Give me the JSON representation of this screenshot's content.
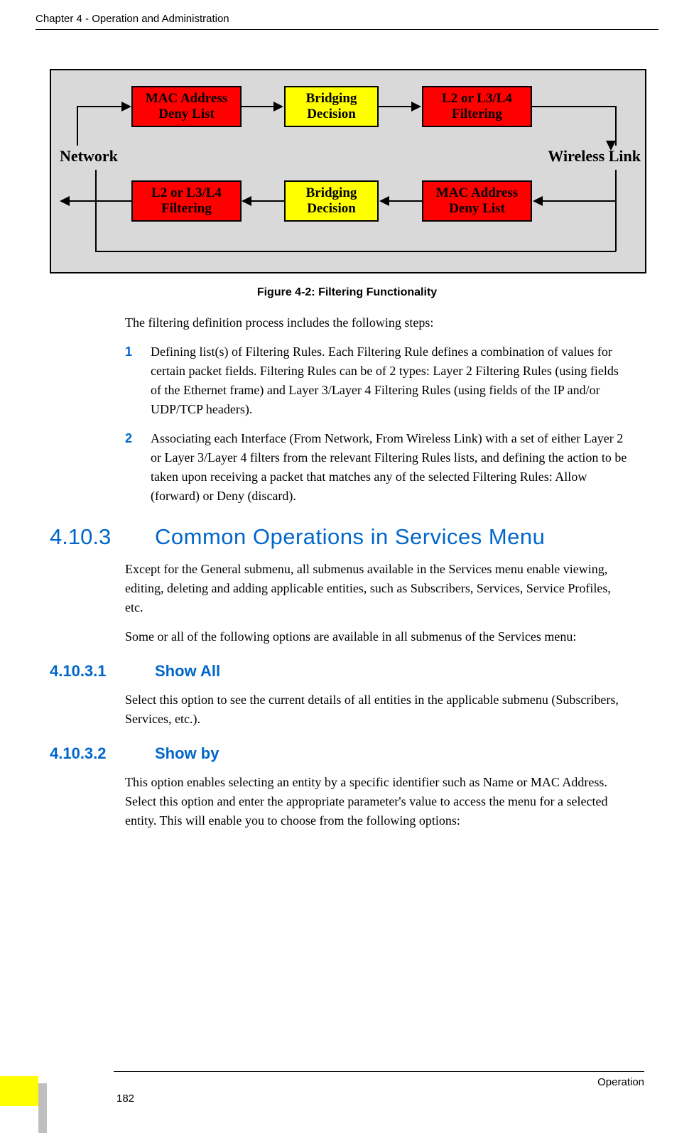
{
  "header": {
    "chapter_line": "Chapter 4 - Operation and Administration"
  },
  "diagram": {
    "network_label": "Network",
    "wireless_label": "Wireless Link",
    "top": {
      "box1_l1": "MAC Address",
      "box1_l2": "Deny List",
      "box2_l1": "Bridging",
      "box2_l2": "Decision",
      "box3_l1": "L2 or L3/L4",
      "box3_l2": "Filtering"
    },
    "bottom": {
      "box1_l1": "L2 or L3/L4",
      "box1_l2": "Filtering",
      "box2_l1": "Bridging",
      "box2_l2": "Decision",
      "box3_l1": "MAC Address",
      "box3_l2": "Deny List"
    }
  },
  "figure_caption": "Figure 4-2: Filtering Functionality",
  "intro": "The filtering definition process includes the following steps:",
  "list": {
    "n1": "1",
    "t1": "Defining list(s) of Filtering Rules. Each Filtering Rule defines a combination of values for certain packet fields. Filtering Rules can be of 2 types: Layer 2 Filtering Rules (using fields of the Ethernet frame) and Layer 3/Layer 4 Filtering Rules (using fields of the IP and/or UDP/TCP headers).",
    "n2": "2",
    "t2": "Associating each Interface (From Network, From Wireless Link) with a set of either Layer 2 or Layer 3/Layer 4 filters from the relevant Filtering Rules lists, and defining the action to be taken upon receiving a packet that matches any of the selected Filtering Rules: Allow (forward) or Deny (discard)."
  },
  "sec4103": {
    "num": "4.10.3",
    "title": "Common Operations in Services Menu",
    "p1": "Except for the General submenu, all submenus available in the Services menu enable viewing, editing, deleting and adding applicable entities, such as Subscribers, Services, Service Profiles, etc.",
    "p2": "Some or all of the following options are available in all submenus of the Services menu:"
  },
  "sec41031": {
    "num": "4.10.3.1",
    "title": "Show All",
    "p1": "Select this option to see the current details of all entities in the applicable submenu (Subscribers, Services, etc.)."
  },
  "sec41032": {
    "num": "4.10.3.2",
    "title": "Show by",
    "p1": "This option enables selecting an entity by a specific identifier such as Name or MAC Address. Select this option and enter the appropriate parameter's value to access the menu for a selected entity. This will enable you to choose from the following options:"
  },
  "footer": {
    "page": "182",
    "section": "Operation"
  }
}
